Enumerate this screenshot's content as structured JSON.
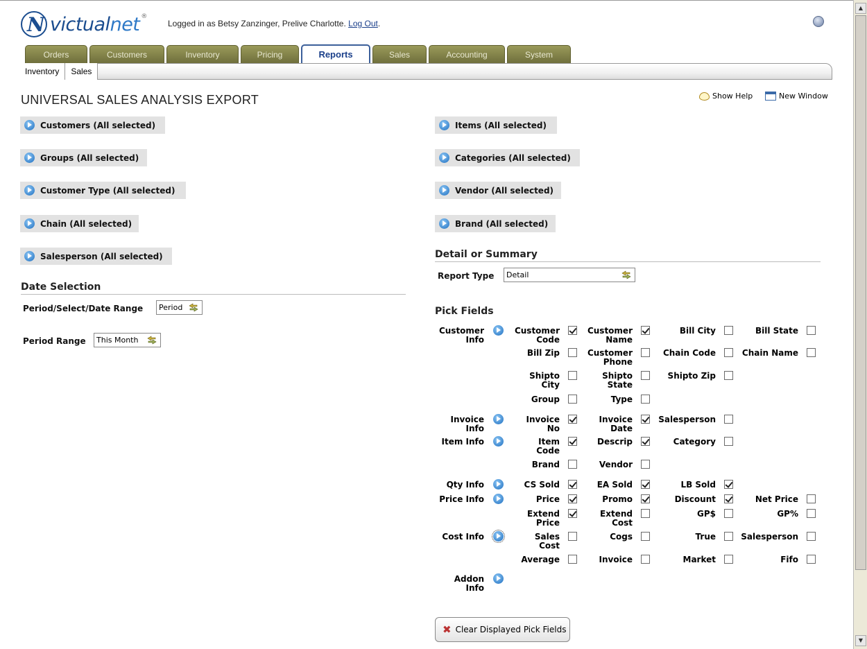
{
  "header": {
    "logo_text_a": "victual",
    "logo_text_b": "net",
    "logo_reg": "®",
    "login_prefix": "Logged in as Betsy Zanzinger, Prelive Charlotte. ",
    "logout_label": "Log Out",
    "login_suffix": "."
  },
  "tabs": [
    "Orders",
    "Customers",
    "Inventory",
    "Pricing",
    "Reports",
    "Sales",
    "Accounting",
    "System"
  ],
  "active_tab": "Reports",
  "subtabs": [
    "Inventory",
    "Sales"
  ],
  "page": {
    "title": "UNIVERSAL SALES ANALYSIS EXPORT",
    "show_help": "Show Help",
    "new_window": "New Window"
  },
  "filters_left": [
    "Customers (All selected)",
    "Groups (All selected)",
    "Customer Type (All selected)",
    "Chain (All selected)",
    "Salesperson (All selected)"
  ],
  "filters_right": [
    "Items (All selected)",
    "Categories (All selected)",
    "Vendor (All selected)",
    "Brand (All selected)"
  ],
  "date_selection": {
    "heading": "Date Selection",
    "period_label": "Period/Select/Date Range",
    "period_value": "Period",
    "range_label": "Period Range",
    "range_value": "This Month"
  },
  "detail_summary": {
    "heading": "Detail or Summary",
    "report_type_label": "Report Type",
    "report_type_value": "Detail"
  },
  "pick_fields": {
    "heading": "Pick Fields",
    "groups": {
      "customer": [
        "Customer",
        "Info"
      ],
      "invoice": [
        "Invoice",
        "Info"
      ],
      "item": [
        "Item Info"
      ],
      "qty": [
        "Qty Info"
      ],
      "price": [
        "Price Info"
      ],
      "cost": [
        "Cost Info"
      ],
      "addon": [
        "Addon",
        "Info"
      ]
    },
    "fields": {
      "customer_code": {
        "label": [
          "Customer",
          "Code"
        ],
        "checked": true
      },
      "customer_name": {
        "label": [
          "Customer",
          "Name"
        ],
        "checked": true
      },
      "bill_city": {
        "label": [
          "Bill City"
        ],
        "checked": false
      },
      "bill_state": {
        "label": [
          "Bill State"
        ],
        "checked": false
      },
      "bill_zip": {
        "label": [
          "Bill Zip"
        ],
        "checked": false
      },
      "customer_phone": {
        "label": [
          "Customer",
          "Phone"
        ],
        "checked": false
      },
      "chain_code": {
        "label": [
          "Chain Code"
        ],
        "checked": false
      },
      "chain_name": {
        "label": [
          "Chain Name"
        ],
        "checked": false
      },
      "shipto_city": {
        "label": [
          "Shipto",
          "City"
        ],
        "checked": false
      },
      "shipto_state": {
        "label": [
          "Shipto",
          "State"
        ],
        "checked": false
      },
      "shipto_zip": {
        "label": [
          "Shipto Zip"
        ],
        "checked": false
      },
      "group": {
        "label": [
          "Group"
        ],
        "checked": false
      },
      "type": {
        "label": [
          "Type"
        ],
        "checked": false
      },
      "invoice_no": {
        "label": [
          "Invoice",
          "No"
        ],
        "checked": true
      },
      "invoice_date": {
        "label": [
          "Invoice",
          "Date"
        ],
        "checked": true
      },
      "salesperson": {
        "label": [
          "Salesperson"
        ],
        "checked": false
      },
      "item_code": {
        "label": [
          "Item",
          "Code"
        ],
        "checked": true
      },
      "descrip": {
        "label": [
          "Descrip"
        ],
        "checked": true
      },
      "category": {
        "label": [
          "Category"
        ],
        "checked": false
      },
      "brand": {
        "label": [
          "Brand"
        ],
        "checked": false
      },
      "vendor": {
        "label": [
          "Vendor"
        ],
        "checked": false
      },
      "cs_sold": {
        "label": [
          "CS Sold"
        ],
        "checked": true
      },
      "ea_sold": {
        "label": [
          "EA Sold"
        ],
        "checked": true
      },
      "lb_sold": {
        "label": [
          "LB Sold"
        ],
        "checked": true
      },
      "price": {
        "label": [
          "Price"
        ],
        "checked": true
      },
      "promo": {
        "label": [
          "Promo"
        ],
        "checked": true
      },
      "discount": {
        "label": [
          "Discount"
        ],
        "checked": true
      },
      "net_price": {
        "label": [
          "Net Price"
        ],
        "checked": false
      },
      "extend_price": {
        "label": [
          "Extend",
          "Price"
        ],
        "checked": true
      },
      "extend_cost": {
        "label": [
          "Extend",
          "Cost"
        ],
        "checked": false
      },
      "gp_dollar": {
        "label": [
          "GP$"
        ],
        "checked": false
      },
      "gp_pct": {
        "label": [
          "GP%"
        ],
        "checked": false
      },
      "sales_cost": {
        "label": [
          "Sales",
          "Cost"
        ],
        "checked": false
      },
      "cogs": {
        "label": [
          "Cogs"
        ],
        "checked": false
      },
      "true_cost": {
        "label": [
          "True"
        ],
        "checked": false
      },
      "salesperson_cost": {
        "label": [
          "Salesperson"
        ],
        "checked": false
      },
      "average": {
        "label": [
          "Average"
        ],
        "checked": false
      },
      "invoice_cost": {
        "label": [
          "Invoice"
        ],
        "checked": false
      },
      "market": {
        "label": [
          "Market"
        ],
        "checked": false
      },
      "fifo": {
        "label": [
          "Fifo"
        ],
        "checked": false
      }
    }
  },
  "clear_button": "Clear Displayed Pick Fields",
  "colors": {
    "brand_blue": "#1b4d8f",
    "tab_olive": "#7f7f45",
    "active_tab_border": "#3b5f9a"
  }
}
